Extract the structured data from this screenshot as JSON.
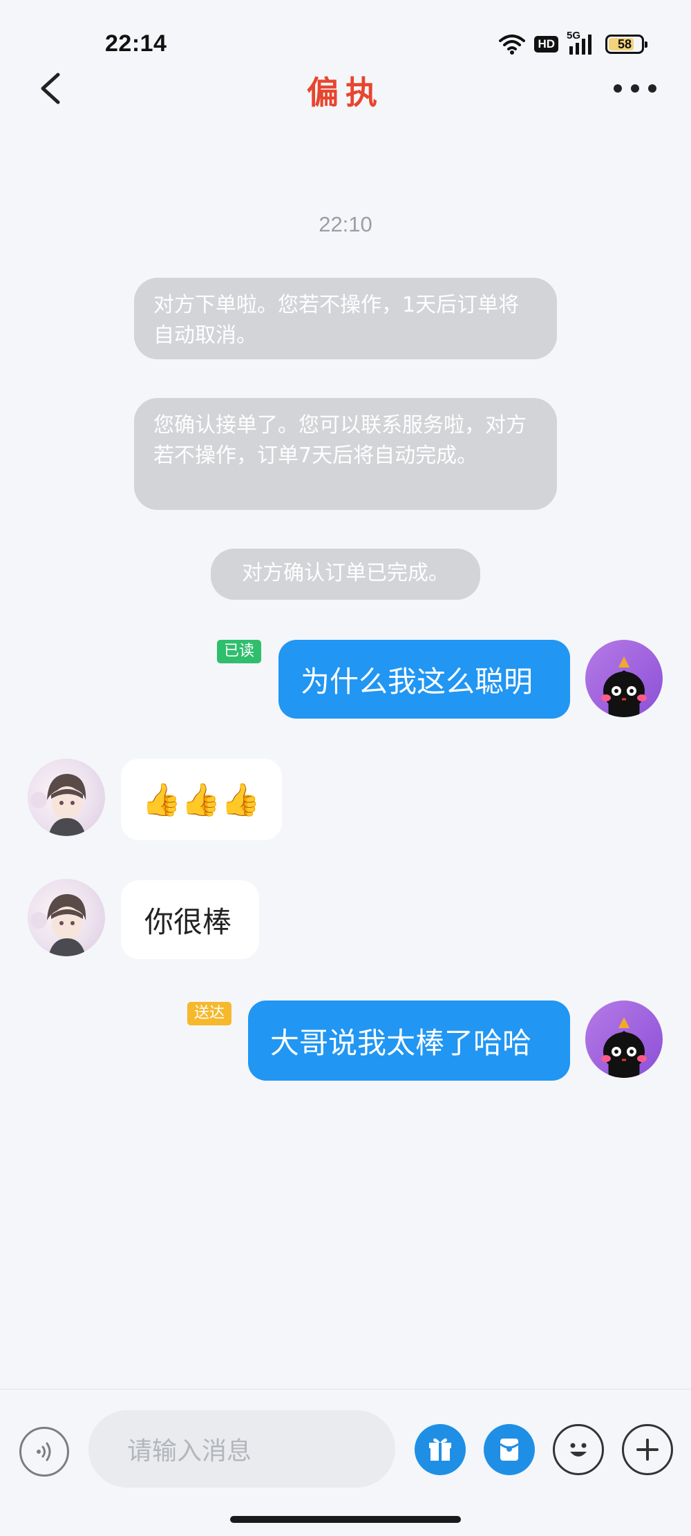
{
  "status_bar": {
    "time": "22:14",
    "hd_label": "HD",
    "network_label": "5G",
    "battery": "58"
  },
  "header": {
    "title": "偏执"
  },
  "chat": {
    "time_label": "22:10",
    "system_messages": [
      "对方下单啦。您若不操作，1天后订单将自动取消。",
      "您确认接单了。您可以联系服务啦，对方若不操作，订单7天后将自动完成。",
      "对方确认订单已完成。"
    ],
    "messages": [
      {
        "side": "me",
        "text": "为什么我这么聪明",
        "status": "已读"
      },
      {
        "side": "them",
        "text": "👍👍👍"
      },
      {
        "side": "them",
        "text": "你很棒"
      },
      {
        "side": "me",
        "text": "大哥说我太棒了哈哈",
        "status": "送达"
      }
    ]
  },
  "composer": {
    "placeholder": "请输入消息"
  },
  "icons": {
    "back": "chevron-left-icon",
    "more": "more-dots-icon",
    "voice": "voice-icon",
    "gift": "gift-icon",
    "red_packet": "red-packet-icon",
    "emoji": "emoji-icon",
    "plus": "plus-icon"
  },
  "colors": {
    "title": "#e8452e",
    "my_bubble": "#2196f3",
    "read_tag": "#2fbe6c",
    "delivered_tag": "#f6b82c"
  }
}
